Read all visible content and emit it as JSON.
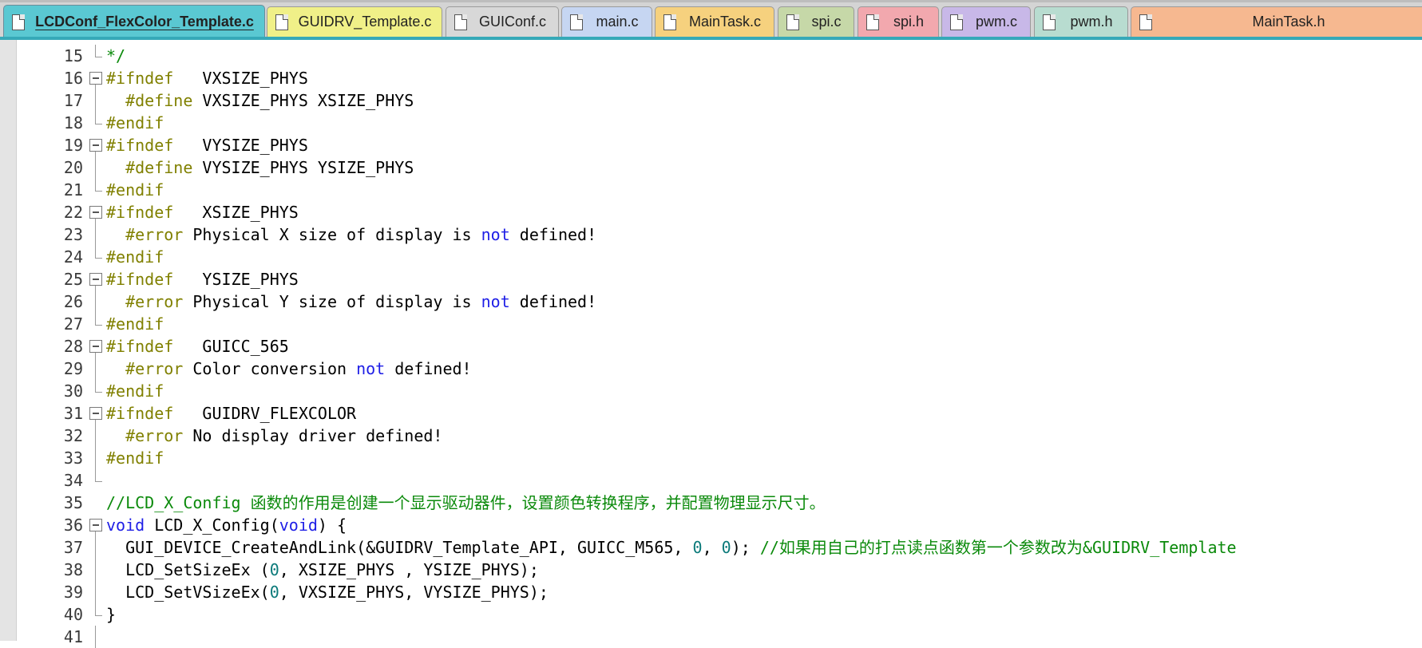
{
  "colors": {
    "preprocessor": "#808000",
    "keyword": "#1e1ee6",
    "number": "#0b7a7a",
    "comment": "#0b8a0b",
    "plain": "#000000",
    "active_tab_underline": "#36a9b8"
  },
  "tabs": [
    {
      "label": "LCDConf_FlexColor_Template.c",
      "icon": "file-icon",
      "color": "#5ac8d2",
      "active": true
    },
    {
      "label": "GUIDRV_Template.c",
      "icon": "file-icon",
      "color": "#f0f088",
      "active": false
    },
    {
      "label": "GUIConf.c",
      "icon": "file-icon",
      "color": "#d8d8d8",
      "active": false
    },
    {
      "label": "main.c",
      "icon": "file-icon",
      "color": "#c6d6f2",
      "active": false
    },
    {
      "label": "MainTask.c",
      "icon": "file-icon",
      "color": "#f6d17e",
      "active": false
    },
    {
      "label": "spi.c",
      "icon": "file-icon",
      "color": "#c6d8a8",
      "active": false
    },
    {
      "label": "spi.h",
      "icon": "file-icon",
      "color": "#f2a8ae",
      "active": false
    },
    {
      "label": "pwm.c",
      "icon": "file-icon",
      "color": "#c8b8e8",
      "active": false
    },
    {
      "label": "pwm.h",
      "icon": "file-icon",
      "color": "#b8dcd0",
      "active": false
    },
    {
      "label": "MainTask.h",
      "icon": "file-icon",
      "color": "#f6b890",
      "active": false
    }
  ],
  "editor": {
    "lines": [
      {
        "num": "15",
        "fold": "end",
        "tokens": [
          {
            "t": "*/",
            "c": "com"
          }
        ]
      },
      {
        "num": "16",
        "fold": "start",
        "tokens": [
          {
            "t": "#ifndef",
            "c": "pre"
          },
          {
            "t": "   VXSIZE_PHYS",
            "c": "plain"
          }
        ]
      },
      {
        "num": "17",
        "fold": "line",
        "tokens": [
          {
            "t": "  #define",
            "c": "pre"
          },
          {
            "t": " VXSIZE_PHYS XSIZE_PHYS",
            "c": "plain"
          }
        ]
      },
      {
        "num": "18",
        "fold": "end",
        "tokens": [
          {
            "t": "#endif",
            "c": "pre"
          }
        ]
      },
      {
        "num": "19",
        "fold": "start",
        "tokens": [
          {
            "t": "#ifndef",
            "c": "pre"
          },
          {
            "t": "   VYSIZE_PHYS",
            "c": "plain"
          }
        ]
      },
      {
        "num": "20",
        "fold": "line",
        "tokens": [
          {
            "t": "  #define",
            "c": "pre"
          },
          {
            "t": " VYSIZE_PHYS YSIZE_PHYS",
            "c": "plain"
          }
        ]
      },
      {
        "num": "21",
        "fold": "end",
        "tokens": [
          {
            "t": "#endif",
            "c": "pre"
          }
        ]
      },
      {
        "num": "22",
        "fold": "start",
        "tokens": [
          {
            "t": "#ifndef",
            "c": "pre"
          },
          {
            "t": "   XSIZE_PHYS",
            "c": "plain"
          }
        ]
      },
      {
        "num": "23",
        "fold": "line",
        "tokens": [
          {
            "t": "  #error",
            "c": "pre"
          },
          {
            "t": " Physical X size of display is ",
            "c": "plain"
          },
          {
            "t": "not",
            "c": "kw"
          },
          {
            "t": " defined!",
            "c": "plain"
          }
        ]
      },
      {
        "num": "24",
        "fold": "end",
        "tokens": [
          {
            "t": "#endif",
            "c": "pre"
          }
        ]
      },
      {
        "num": "25",
        "fold": "start",
        "tokens": [
          {
            "t": "#ifndef",
            "c": "pre"
          },
          {
            "t": "   YSIZE_PHYS",
            "c": "plain"
          }
        ]
      },
      {
        "num": "26",
        "fold": "line",
        "tokens": [
          {
            "t": "  #error",
            "c": "pre"
          },
          {
            "t": " Physical Y size of display is ",
            "c": "plain"
          },
          {
            "t": "not",
            "c": "kw"
          },
          {
            "t": " defined!",
            "c": "plain"
          }
        ]
      },
      {
        "num": "27",
        "fold": "end",
        "tokens": [
          {
            "t": "#endif",
            "c": "pre"
          }
        ]
      },
      {
        "num": "28",
        "fold": "start",
        "tokens": [
          {
            "t": "#ifndef",
            "c": "pre"
          },
          {
            "t": "   GUICC_565",
            "c": "plain"
          }
        ]
      },
      {
        "num": "29",
        "fold": "line",
        "tokens": [
          {
            "t": "  #error",
            "c": "pre"
          },
          {
            "t": " Color conversion ",
            "c": "plain"
          },
          {
            "t": "not",
            "c": "kw"
          },
          {
            "t": " defined!",
            "c": "plain"
          }
        ]
      },
      {
        "num": "30",
        "fold": "end",
        "tokens": [
          {
            "t": "#endif",
            "c": "pre"
          }
        ]
      },
      {
        "num": "31",
        "fold": "start",
        "tokens": [
          {
            "t": "#ifndef",
            "c": "pre"
          },
          {
            "t": "   GUIDRV_FLEXCOLOR",
            "c": "plain"
          }
        ]
      },
      {
        "num": "32",
        "fold": "line",
        "tokens": [
          {
            "t": "  #error",
            "c": "pre"
          },
          {
            "t": " No display driver defined!",
            "c": "plain"
          }
        ]
      },
      {
        "num": "33",
        "fold": "line",
        "tokens": [
          {
            "t": "#endif",
            "c": "pre"
          }
        ]
      },
      {
        "num": "34",
        "fold": "end",
        "tokens": []
      },
      {
        "num": "35",
        "fold": "none",
        "tokens": [
          {
            "t": "//LCD_X_Config 函数的作用是创建一个显示驱动器件，设置颜色转换程序，并配置物理显示尺寸。",
            "c": "com"
          }
        ]
      },
      {
        "num": "36",
        "fold": "start",
        "tokens": [
          {
            "t": "void",
            "c": "kw"
          },
          {
            "t": " LCD_X_Config(",
            "c": "plain"
          },
          {
            "t": "void",
            "c": "kw"
          },
          {
            "t": ") {",
            "c": "plain"
          }
        ]
      },
      {
        "num": "37",
        "fold": "line",
        "tokens": [
          {
            "t": "  GUI_DEVICE_CreateAndLink(&GUIDRV_Template_API, GUICC_M565, ",
            "c": "plain"
          },
          {
            "t": "0",
            "c": "num"
          },
          {
            "t": ", ",
            "c": "plain"
          },
          {
            "t": "0",
            "c": "num"
          },
          {
            "t": "); ",
            "c": "plain"
          },
          {
            "t": "//如果用自己的打点读点函数第一个参数改为&GUIDRV_Template",
            "c": "com"
          }
        ]
      },
      {
        "num": "38",
        "fold": "line",
        "tokens": [
          {
            "t": "  LCD_SetSizeEx (",
            "c": "plain"
          },
          {
            "t": "0",
            "c": "num"
          },
          {
            "t": ", XSIZE_PHYS , YSIZE_PHYS);",
            "c": "plain"
          }
        ]
      },
      {
        "num": "39",
        "fold": "line",
        "tokens": [
          {
            "t": "  LCD_SetVSizeEx(",
            "c": "plain"
          },
          {
            "t": "0",
            "c": "num"
          },
          {
            "t": ", VXSIZE_PHYS, VYSIZE_PHYS);",
            "c": "plain"
          }
        ]
      },
      {
        "num": "40",
        "fold": "end",
        "tokens": [
          {
            "t": "}",
            "c": "plain"
          }
        ]
      },
      {
        "num": "41",
        "fold": "line",
        "tokens": []
      }
    ]
  }
}
